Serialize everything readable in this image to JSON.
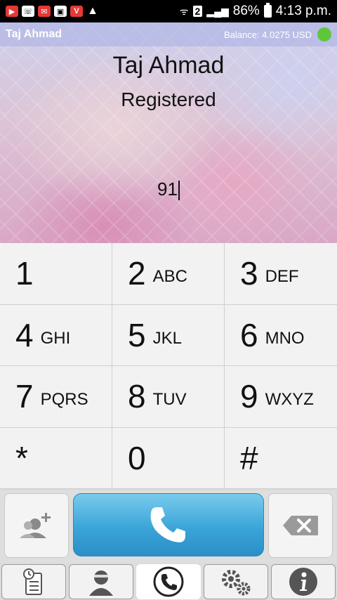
{
  "status_bar": {
    "time": "4:13 p.m.",
    "battery": "86%",
    "sim_label": "2",
    "icons": [
      "youtube-icon",
      "whatsapp-icon",
      "message-icon",
      "gallery-icon",
      "v-app-icon",
      "warning-icon",
      "wifi-icon",
      "signal-icon",
      "battery-icon"
    ]
  },
  "account": {
    "name": "Taj Ahmad",
    "balance": "Balance: 4.0275 USD",
    "status_color": "#5fc63b"
  },
  "contact": {
    "name": "Taj Ahmad",
    "status": "Registered"
  },
  "dialer": {
    "input_value": "91"
  },
  "keypad": [
    {
      "digit": "1",
      "letters": ""
    },
    {
      "digit": "2",
      "letters": "ABC"
    },
    {
      "digit": "3",
      "letters": "DEF"
    },
    {
      "digit": "4",
      "letters": "GHI"
    },
    {
      "digit": "5",
      "letters": "JKL"
    },
    {
      "digit": "6",
      "letters": "MNO"
    },
    {
      "digit": "7",
      "letters": "PQRS"
    },
    {
      "digit": "8",
      "letters": "TUV"
    },
    {
      "digit": "9",
      "letters": "WXYZ"
    },
    {
      "digit": "*",
      "letters": ""
    },
    {
      "digit": "0",
      "letters": ""
    },
    {
      "digit": "#",
      "letters": ""
    }
  ],
  "actions": {
    "call_color": "#3aa5d8",
    "add_contact_icon": "add-contact-icon",
    "call_icon": "phone-icon",
    "backspace_icon": "backspace-icon"
  },
  "bottom_nav": [
    "call-log-icon",
    "contacts-icon",
    "dialer-icon",
    "settings-icon",
    "info-icon"
  ]
}
